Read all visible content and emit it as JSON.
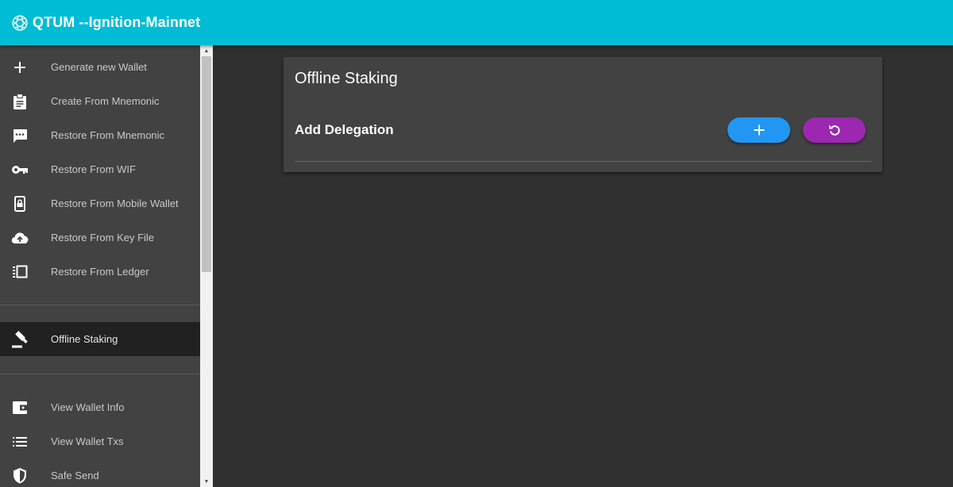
{
  "app": {
    "title": "QTUM --Ignition-Mainnet",
    "brand_color": "#00bcd4"
  },
  "sidebar": {
    "items": [
      {
        "label": "Generate new Wallet",
        "icon": "plus-icon"
      },
      {
        "label": "Create From Mnemonic",
        "icon": "clipboard-icon"
      },
      {
        "label": "Restore From Mnemonic",
        "icon": "chat-bubble-icon"
      },
      {
        "label": "Restore From WIF",
        "icon": "key-icon"
      },
      {
        "label": "Restore From Mobile Wallet",
        "icon": "mobile-lock-icon"
      },
      {
        "label": "Restore From Key File",
        "icon": "cloud-upload-icon"
      },
      {
        "label": "Restore From Ledger",
        "icon": "ledger-icon"
      },
      {
        "label": "Offline Staking",
        "icon": "gavel-icon",
        "active": true
      },
      {
        "label": "View Wallet Info",
        "icon": "wallet-icon"
      },
      {
        "label": "View Wallet Txs",
        "icon": "list-icon"
      },
      {
        "label": "Safe Send",
        "icon": "shield-icon"
      }
    ]
  },
  "main": {
    "card": {
      "title": "Offline Staking",
      "section_title": "Add Delegation",
      "add_button_icon": "plus-icon",
      "add_button_color": "#2196f3",
      "refresh_button_icon": "refresh-icon",
      "refresh_button_color": "#9c27b0"
    }
  }
}
